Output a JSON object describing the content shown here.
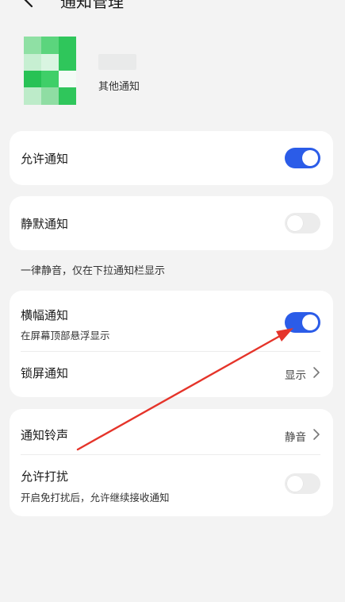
{
  "header": {
    "title": "通知管理"
  },
  "app": {
    "name": "其他通知"
  },
  "cards": {
    "allow": {
      "label": "允许通知"
    },
    "silent": {
      "label": "静默通知",
      "note": "一律静音，仅在下拉通知栏显示"
    },
    "banner": {
      "label": "横幅通知",
      "sub": "在屏幕顶部悬浮显示"
    },
    "lock": {
      "label": "锁屏通知",
      "value": "显示"
    },
    "ringtone": {
      "label": "通知铃声",
      "value": "静音"
    },
    "dnd": {
      "label": "允许打扰",
      "sub": "开启免打扰后，允许继续接收通知"
    }
  },
  "toggles": {
    "allow": true,
    "silent": false,
    "banner": true,
    "dnd": false
  },
  "colors": {
    "accent": "#2b5ce8",
    "annotation": "#e5342a",
    "icon_green": "#3dcf67"
  },
  "icons": {
    "back": "chevron-left-icon",
    "app": "app-icon",
    "chevron": "chevron-right-icon"
  }
}
